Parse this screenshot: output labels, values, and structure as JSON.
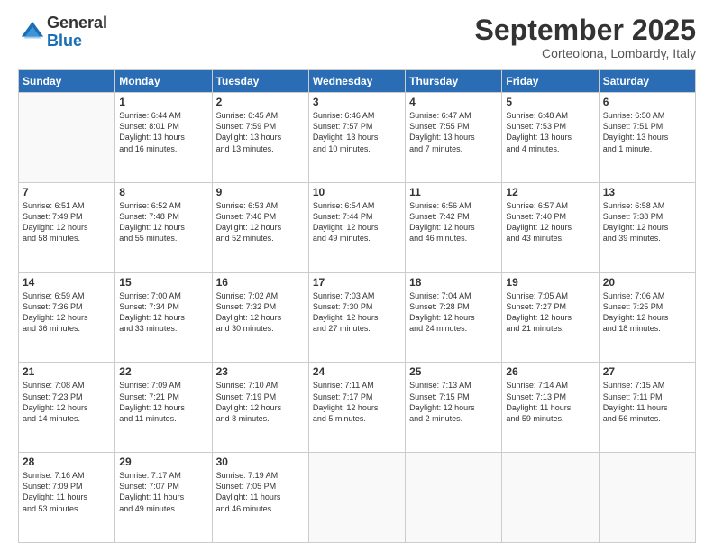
{
  "logo": {
    "general": "General",
    "blue": "Blue"
  },
  "title": "September 2025",
  "location": "Corteolona, Lombardy, Italy",
  "days": [
    "Sunday",
    "Monday",
    "Tuesday",
    "Wednesday",
    "Thursday",
    "Friday",
    "Saturday"
  ],
  "weeks": [
    [
      {
        "day": "",
        "text": ""
      },
      {
        "day": "1",
        "text": "Sunrise: 6:44 AM\nSunset: 8:01 PM\nDaylight: 13 hours\nand 16 minutes."
      },
      {
        "day": "2",
        "text": "Sunrise: 6:45 AM\nSunset: 7:59 PM\nDaylight: 13 hours\nand 13 minutes."
      },
      {
        "day": "3",
        "text": "Sunrise: 6:46 AM\nSunset: 7:57 PM\nDaylight: 13 hours\nand 10 minutes."
      },
      {
        "day": "4",
        "text": "Sunrise: 6:47 AM\nSunset: 7:55 PM\nDaylight: 13 hours\nand 7 minutes."
      },
      {
        "day": "5",
        "text": "Sunrise: 6:48 AM\nSunset: 7:53 PM\nDaylight: 13 hours\nand 4 minutes."
      },
      {
        "day": "6",
        "text": "Sunrise: 6:50 AM\nSunset: 7:51 PM\nDaylight: 13 hours\nand 1 minute."
      }
    ],
    [
      {
        "day": "7",
        "text": "Sunrise: 6:51 AM\nSunset: 7:49 PM\nDaylight: 12 hours\nand 58 minutes."
      },
      {
        "day": "8",
        "text": "Sunrise: 6:52 AM\nSunset: 7:48 PM\nDaylight: 12 hours\nand 55 minutes."
      },
      {
        "day": "9",
        "text": "Sunrise: 6:53 AM\nSunset: 7:46 PM\nDaylight: 12 hours\nand 52 minutes."
      },
      {
        "day": "10",
        "text": "Sunrise: 6:54 AM\nSunset: 7:44 PM\nDaylight: 12 hours\nand 49 minutes."
      },
      {
        "day": "11",
        "text": "Sunrise: 6:56 AM\nSunset: 7:42 PM\nDaylight: 12 hours\nand 46 minutes."
      },
      {
        "day": "12",
        "text": "Sunrise: 6:57 AM\nSunset: 7:40 PM\nDaylight: 12 hours\nand 43 minutes."
      },
      {
        "day": "13",
        "text": "Sunrise: 6:58 AM\nSunset: 7:38 PM\nDaylight: 12 hours\nand 39 minutes."
      }
    ],
    [
      {
        "day": "14",
        "text": "Sunrise: 6:59 AM\nSunset: 7:36 PM\nDaylight: 12 hours\nand 36 minutes."
      },
      {
        "day": "15",
        "text": "Sunrise: 7:00 AM\nSunset: 7:34 PM\nDaylight: 12 hours\nand 33 minutes."
      },
      {
        "day": "16",
        "text": "Sunrise: 7:02 AM\nSunset: 7:32 PM\nDaylight: 12 hours\nand 30 minutes."
      },
      {
        "day": "17",
        "text": "Sunrise: 7:03 AM\nSunset: 7:30 PM\nDaylight: 12 hours\nand 27 minutes."
      },
      {
        "day": "18",
        "text": "Sunrise: 7:04 AM\nSunset: 7:28 PM\nDaylight: 12 hours\nand 24 minutes."
      },
      {
        "day": "19",
        "text": "Sunrise: 7:05 AM\nSunset: 7:27 PM\nDaylight: 12 hours\nand 21 minutes."
      },
      {
        "day": "20",
        "text": "Sunrise: 7:06 AM\nSunset: 7:25 PM\nDaylight: 12 hours\nand 18 minutes."
      }
    ],
    [
      {
        "day": "21",
        "text": "Sunrise: 7:08 AM\nSunset: 7:23 PM\nDaylight: 12 hours\nand 14 minutes."
      },
      {
        "day": "22",
        "text": "Sunrise: 7:09 AM\nSunset: 7:21 PM\nDaylight: 12 hours\nand 11 minutes."
      },
      {
        "day": "23",
        "text": "Sunrise: 7:10 AM\nSunset: 7:19 PM\nDaylight: 12 hours\nand 8 minutes."
      },
      {
        "day": "24",
        "text": "Sunrise: 7:11 AM\nSunset: 7:17 PM\nDaylight: 12 hours\nand 5 minutes."
      },
      {
        "day": "25",
        "text": "Sunrise: 7:13 AM\nSunset: 7:15 PM\nDaylight: 12 hours\nand 2 minutes."
      },
      {
        "day": "26",
        "text": "Sunrise: 7:14 AM\nSunset: 7:13 PM\nDaylight: 11 hours\nand 59 minutes."
      },
      {
        "day": "27",
        "text": "Sunrise: 7:15 AM\nSunset: 7:11 PM\nDaylight: 11 hours\nand 56 minutes."
      }
    ],
    [
      {
        "day": "28",
        "text": "Sunrise: 7:16 AM\nSunset: 7:09 PM\nDaylight: 11 hours\nand 53 minutes."
      },
      {
        "day": "29",
        "text": "Sunrise: 7:17 AM\nSunset: 7:07 PM\nDaylight: 11 hours\nand 49 minutes."
      },
      {
        "day": "30",
        "text": "Sunrise: 7:19 AM\nSunset: 7:05 PM\nDaylight: 11 hours\nand 46 minutes."
      },
      {
        "day": "",
        "text": ""
      },
      {
        "day": "",
        "text": ""
      },
      {
        "day": "",
        "text": ""
      },
      {
        "day": "",
        "text": ""
      }
    ]
  ]
}
